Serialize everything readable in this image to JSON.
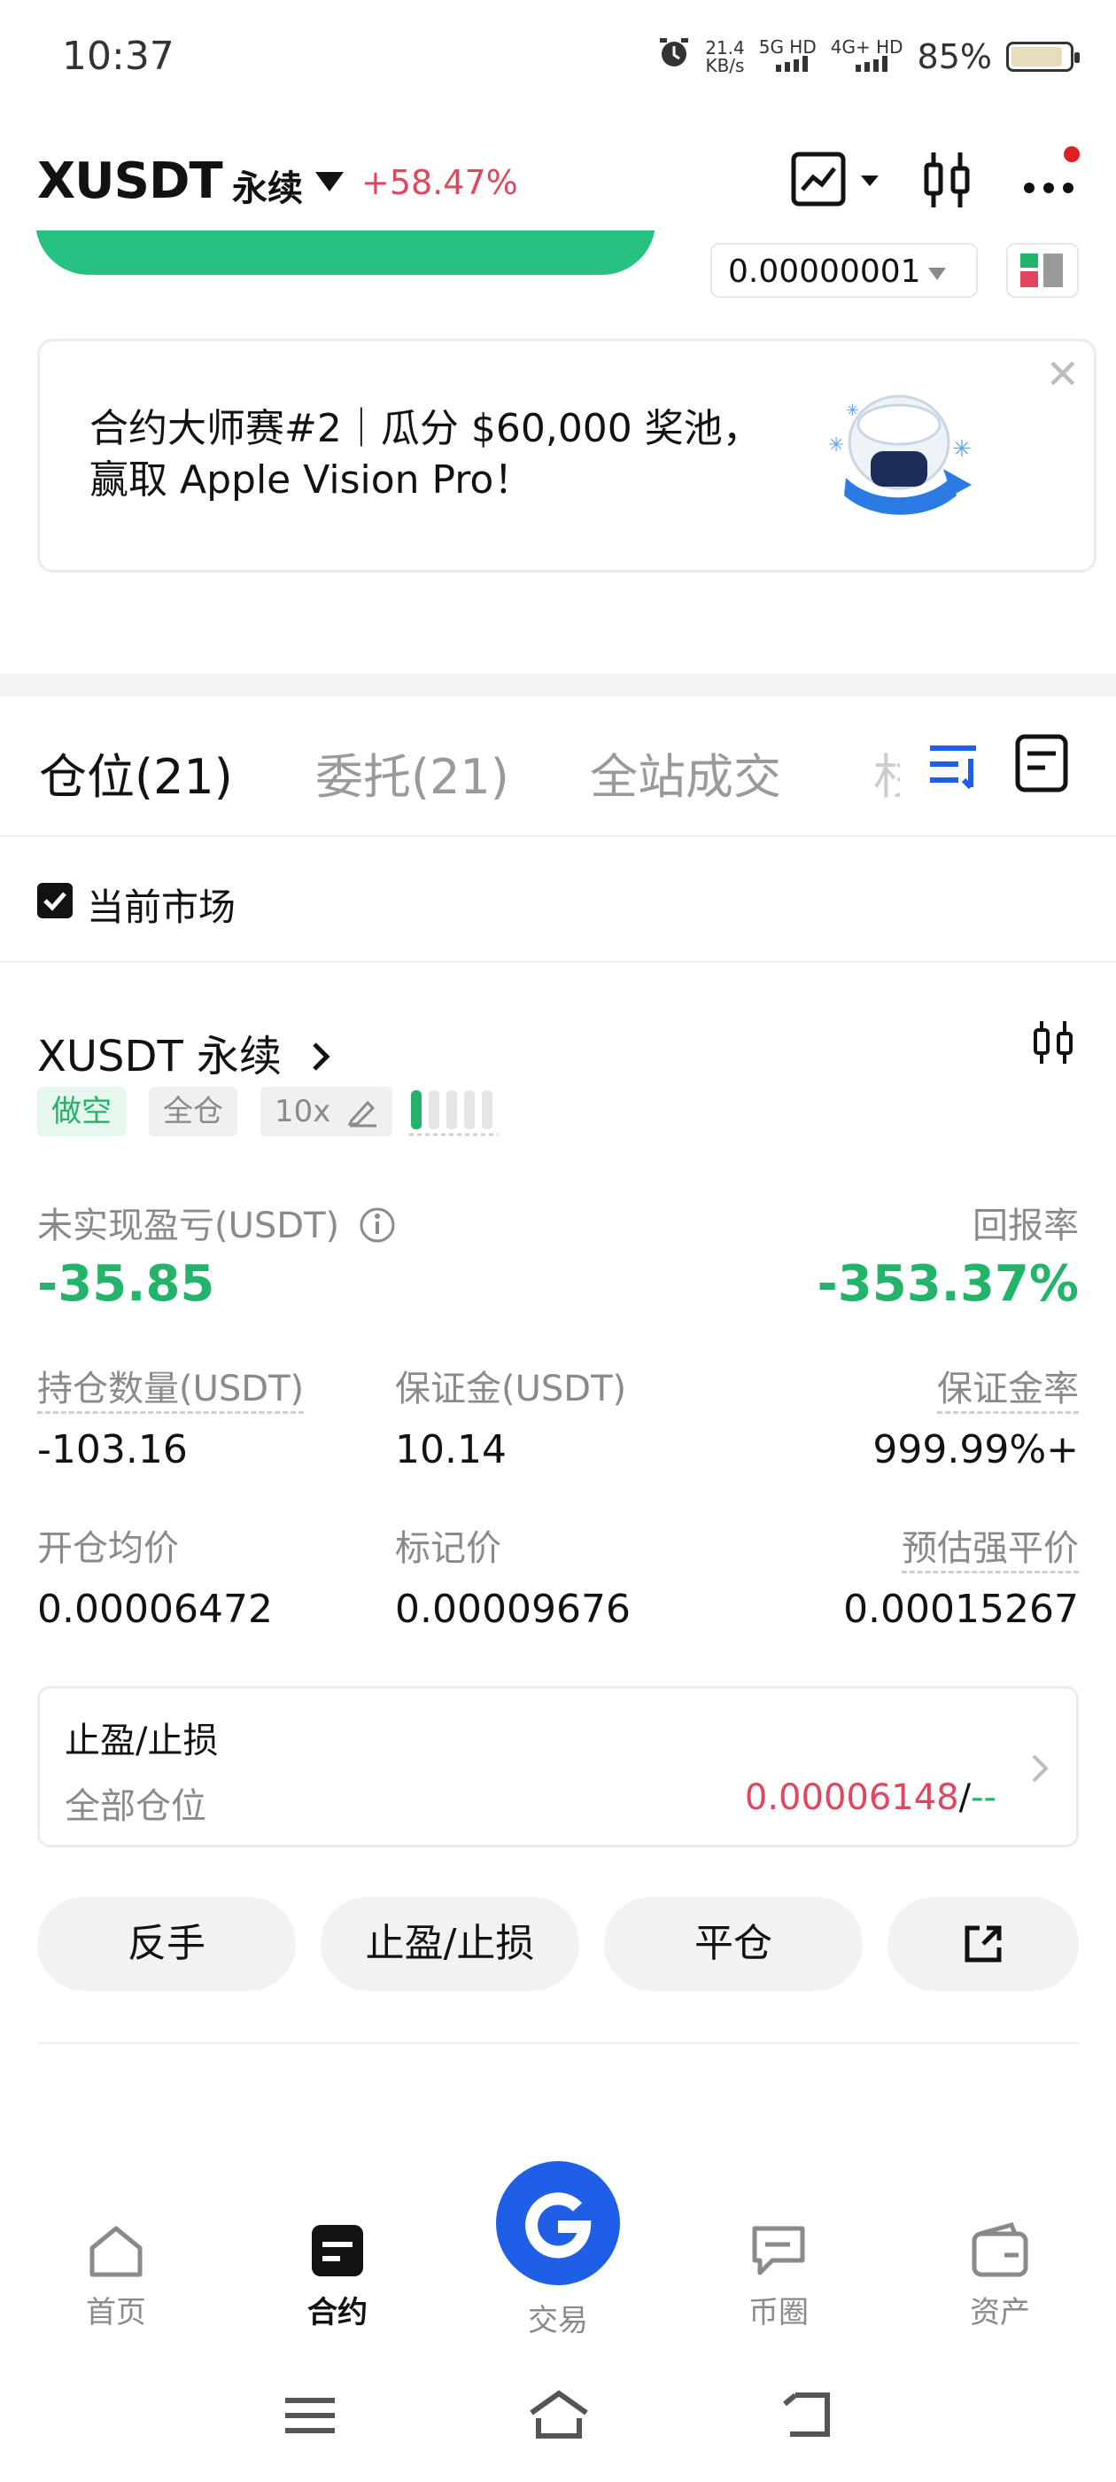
{
  "status_bar": {
    "time": "10:37",
    "net_speed_value": "21.4",
    "net_speed_unit": "KB/s",
    "signal1": "5G HD",
    "signal2": "4G+ HD",
    "battery": "85%",
    "battery_level": 0.85
  },
  "header": {
    "symbol": "XUSDT",
    "contract_type": "永续",
    "change": "+58.47%"
  },
  "orderbook_controls": {
    "precision": "0.00000001"
  },
  "banner": {
    "text": "合约大师赛#2｜瓜分 $60,000 奖池，赢取 Apple Vision Pro！"
  },
  "tabs": [
    {
      "label": "仓位(21)"
    },
    {
      "label": "委托(21)"
    },
    {
      "label": "全站成交"
    },
    {
      "label": "杉"
    }
  ],
  "filter": {
    "current_market_label": "当前市场",
    "checked": true
  },
  "position": {
    "name": "XUSDT 永续",
    "side_tag": "做空",
    "margin_mode_tag": "全仓",
    "leverage_tag": "10x",
    "pnl_label": "未实现盈亏(USDT)",
    "pnl_value": "-35.85",
    "roe_label": "回报率",
    "roe_value": "-353.37%",
    "size_label": "持仓数量(USDT)",
    "size_value": "-103.16",
    "margin_label": "保证金(USDT)",
    "margin_value": "10.14",
    "margin_ratio_label": "保证金率",
    "margin_ratio_value": "999.99%+",
    "entry_label": "开仓均价",
    "entry_value": "0.00006472",
    "mark_label": "标记价",
    "mark_value": "0.00009676",
    "liq_label": "预估强平价",
    "liq_value": "0.00015267",
    "tpsl_title": "止盈/止损",
    "tpsl_scope": "全部仓位",
    "tp_value": "0.00006148",
    "sl_sep": "/",
    "sl_value": "--",
    "buttons": {
      "reverse": "反手",
      "tpsl": "止盈/止损",
      "close": "平仓"
    }
  },
  "bottom_nav": [
    {
      "label": "首页"
    },
    {
      "label": "合约"
    },
    {
      "label": "交易"
    },
    {
      "label": "币圈"
    },
    {
      "label": "资产"
    }
  ],
  "colors": {
    "green": "#23b36b",
    "red": "#e0475f",
    "blue": "#1f5ee6"
  }
}
